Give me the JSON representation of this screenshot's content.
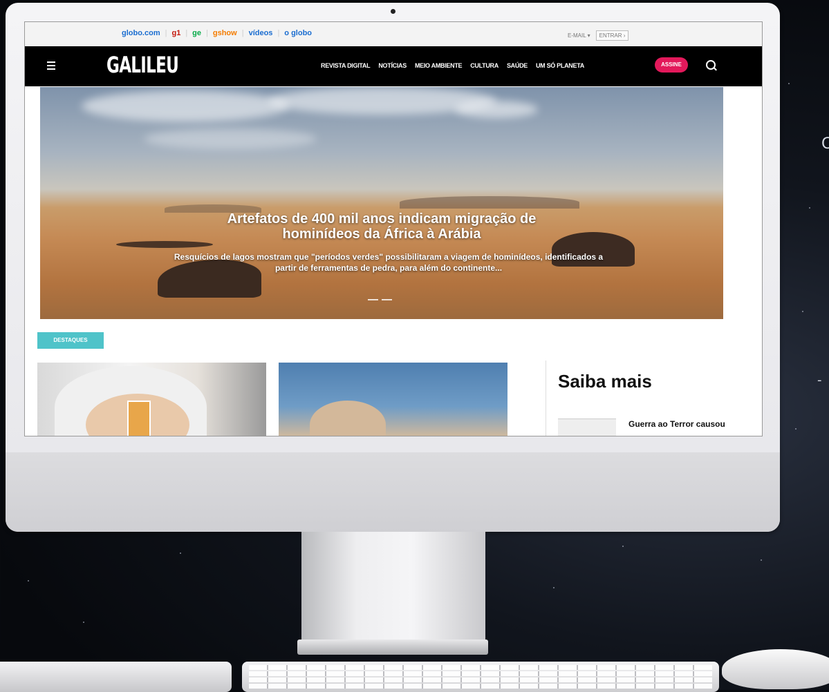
{
  "edge_texts": {
    "right_c": "C",
    "right_dash": "-"
  },
  "topbar": {
    "brands": [
      {
        "label": "globo.com",
        "color": "#1a6dd0"
      },
      {
        "label": "g1",
        "color": "#c4170c"
      },
      {
        "label": "ge",
        "color": "#06aa48"
      },
      {
        "label": "gshow",
        "color": "#f47c00"
      },
      {
        "label": "vídeos",
        "color": "#1a6dd0"
      },
      {
        "label": "o globo",
        "color": "#1a6dd0"
      }
    ],
    "email_label": "E-MAIL",
    "entrar_label": "ENTRAR ›"
  },
  "nav": {
    "logo": "GALILEU",
    "items": [
      "REVISTA DIGITAL",
      "NOTÍCIAS",
      "MEIO AMBIENTE",
      "CULTURA",
      "SAÚDE",
      "UM SÓ PLANETA"
    ],
    "subscribe": "ASSINE"
  },
  "hero": {
    "title_line1": "Artefatos de 400 mil anos indicam migração de",
    "title_line2": "hominídeos da África à Arábia",
    "summary": "Resquícios de lagos mostram que \"períodos verdes\" possibilitaram a viagem de hominídeos, identificados a partir de ferramentas de pedra, para além do continente..."
  },
  "section_badge": "DESTAQUES",
  "sidebar": {
    "title": "Saiba mais",
    "first_item": "Guerra ao Terror causou"
  },
  "colors": {
    "accent": "#e3195b",
    "badge": "#4fc3c9",
    "nav_bg": "#000000"
  }
}
